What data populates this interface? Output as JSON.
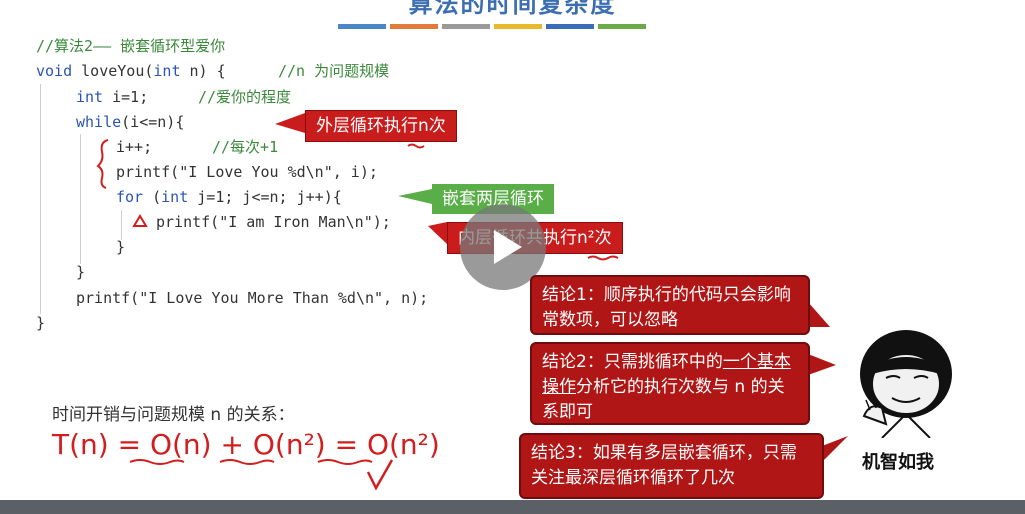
{
  "slide": {
    "title": "算法的时间复杂度",
    "bar_colors": [
      "#4a86c5",
      "#e07b39",
      "#9a9a9a",
      "#e8b92b",
      "#3a6db5",
      "#6aaa48"
    ]
  },
  "code": {
    "line1": "//算法2—— 嵌套循环型爱你",
    "line2_kw1": "void",
    "line2_fn": " loveYou(",
    "line2_kw2": "int",
    "line2_rest": " n) {",
    "line2_comment": "//n 为问题规模",
    "line3_kw": "int",
    "line3_rest": " i=1;",
    "line3_comment": "//爱你的程度",
    "line4_kw": "while",
    "line4_rest": "(i<=n){",
    "line5": "i++;",
    "line5_comment": "//每次+1",
    "line6": "printf(\"I Love You %d\\n\", i);",
    "line7_kw1": "for",
    "line7_a": " (",
    "line7_kw2": "int",
    "line7_rest": " j=1; j<=n; j++){",
    "line8": "printf(\"I am Iron Man\\n\");",
    "line9": "}",
    "line10": "}",
    "line11": "printf(\"I Love You More Than %d\\n\", n);",
    "line12": "}"
  },
  "callouts": {
    "outer": "外层循环执行n次",
    "nested": "嵌套两层循环",
    "inner": "内层循环共执行n²次"
  },
  "conclusions": {
    "c1": "结论1：顺序执行的代码只会影响常数项，可以忽略",
    "c2_pre": "结论2：只需挑循环中的",
    "c2_u": "一个基本操作",
    "c2_post": "分析它的执行次数与 n 的关系即可",
    "c3": "结论3：如果有多层嵌套循环，只需关注最深层循环循环了几次"
  },
  "relation": {
    "label": "时间开销与问题规模 n 的关系：",
    "formula": "T(n) = O(n) + O(n²) = O(n²)"
  },
  "meme": {
    "caption": "机智如我"
  }
}
